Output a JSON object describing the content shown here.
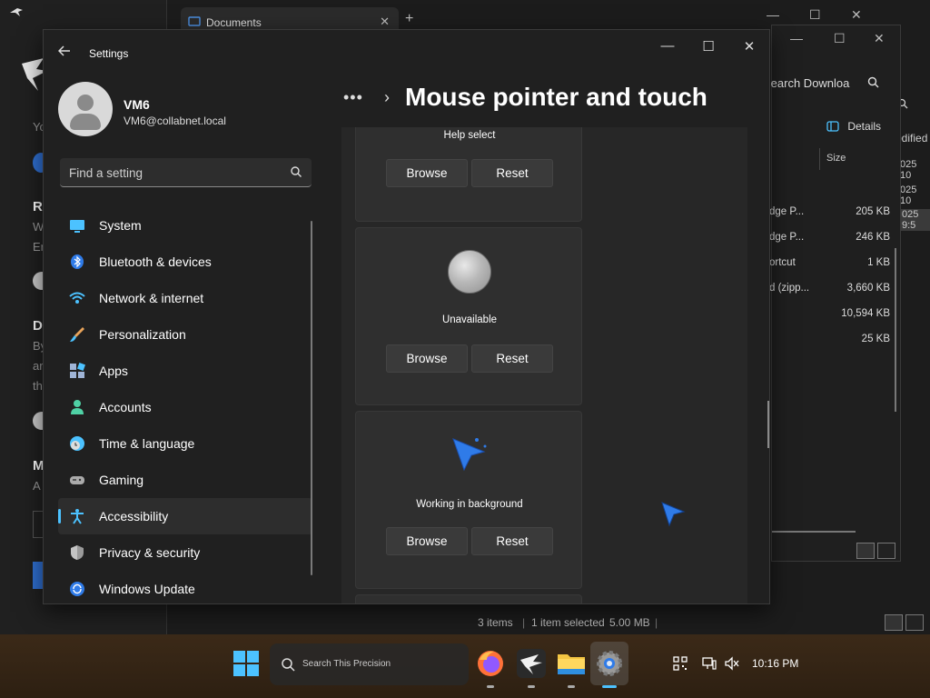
{
  "background_windows": {
    "documents_tab": "Documents",
    "downloads": {
      "search_placeholder": "Search Downloa",
      "details_label": "Details",
      "size_header": "Size",
      "rows": [
        {
          "name": "dge P...",
          "size": "205 KB"
        },
        {
          "name": "dge P...",
          "size": "246 KB"
        },
        {
          "name": "ortcut",
          "size": "1 KB"
        },
        {
          "name": "d (zipp...",
          "size": "3,660 KB"
        },
        {
          "name": "",
          "size": "10,594 KB"
        },
        {
          "name": "",
          "size": "25 KB"
        }
      ]
    },
    "right_strip": {
      "modified_header": "odified",
      "dates": [
        "025 10",
        "025 10",
        "025 9:5"
      ]
    },
    "status": {
      "items": "3 items",
      "selected": "1 item selected",
      "size": "5.00 MB"
    },
    "left_fragments": [
      "Yo",
      "R",
      "W",
      "Er",
      "D",
      "By",
      "ar",
      "th",
      "M",
      "A"
    ]
  },
  "settings": {
    "app_title": "Settings",
    "user": {
      "name": "VM6",
      "email": "VM6@collabnet.local"
    },
    "search_placeholder": "Find a setting",
    "nav_items": [
      {
        "label": "System",
        "icon": "monitor-icon"
      },
      {
        "label": "Bluetooth & devices",
        "icon": "bluetooth-icon"
      },
      {
        "label": "Network & internet",
        "icon": "wifi-icon"
      },
      {
        "label": "Personalization",
        "icon": "brush-icon"
      },
      {
        "label": "Apps",
        "icon": "apps-icon"
      },
      {
        "label": "Accounts",
        "icon": "person-icon"
      },
      {
        "label": "Time & language",
        "icon": "globe-clock-icon"
      },
      {
        "label": "Gaming",
        "icon": "gamepad-icon"
      },
      {
        "label": "Accessibility",
        "icon": "accessibility-icon",
        "active": true
      },
      {
        "label": "Privacy & security",
        "icon": "shield-icon"
      },
      {
        "label": "Windows Update",
        "icon": "update-icon"
      }
    ],
    "breadcrumb_dots": "•••",
    "page_title": "Mouse pointer and touch",
    "cards": [
      {
        "caption": "Help select",
        "browse": "Browse",
        "reset": "Reset"
      },
      {
        "caption": "Unavailable",
        "browse": "Browse",
        "reset": "Reset"
      },
      {
        "caption": "Working in background",
        "browse": "Browse",
        "reset": "Reset"
      }
    ]
  },
  "taskbar": {
    "search_placeholder": "Search This Precision",
    "clock": "10:16 PM",
    "accent": "#4cc2ff"
  }
}
